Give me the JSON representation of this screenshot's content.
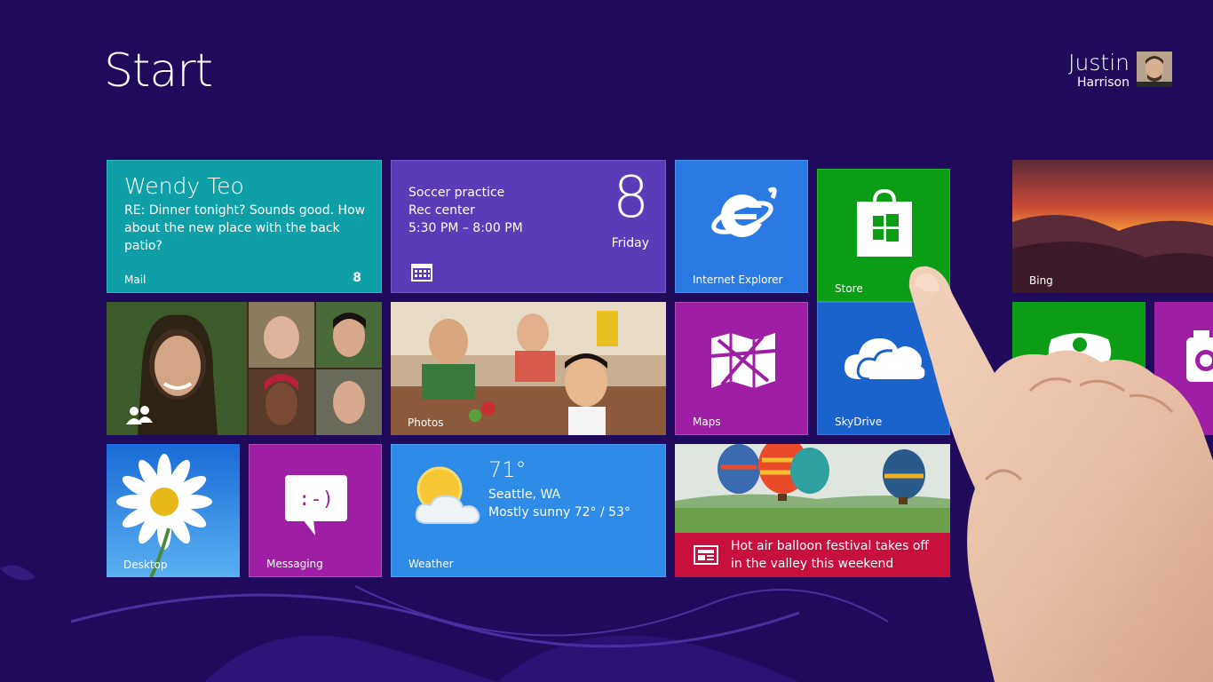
{
  "start": {
    "title": "Start"
  },
  "user": {
    "first_name": "Justin",
    "last_name": "Harrison"
  },
  "tiles": {
    "mail": {
      "label": "Mail",
      "from": "Wendy Teo",
      "subject": "RE: Dinner tonight? Sounds good. How about the new place with the back patio?",
      "count": "8"
    },
    "calendar": {
      "event": "Soccer practice",
      "location": "Rec center",
      "time": "5:30 PM – 8:00 PM",
      "date": "8",
      "day": "Friday"
    },
    "ie": {
      "label": "Internet Explorer"
    },
    "store": {
      "label": "Store"
    },
    "bing": {
      "label": "Bing"
    },
    "photos": {
      "label": "Photos"
    },
    "maps": {
      "label": "Maps"
    },
    "skydrive": {
      "label": "SkyDrive"
    },
    "desktop": {
      "label": "Desktop"
    },
    "messaging": {
      "label": "Messaging"
    },
    "weather": {
      "label": "Weather",
      "temp": "71°",
      "location": "Seattle, WA",
      "condition": "Mostly sunny 72° / 53°"
    },
    "news": {
      "headline": "Hot air balloon festival takes off in the valley this weekend"
    }
  },
  "colors": {
    "background": "#1f0a5c",
    "mail": "#0f9fa8",
    "calendar": "#5a3bb8",
    "ie": "#2b7ae3",
    "store": "#0c9d16",
    "maps": "#9e1fa3",
    "skydrive": "#1a62cc",
    "weather": "#2e8be8",
    "news": "#c8103f"
  }
}
